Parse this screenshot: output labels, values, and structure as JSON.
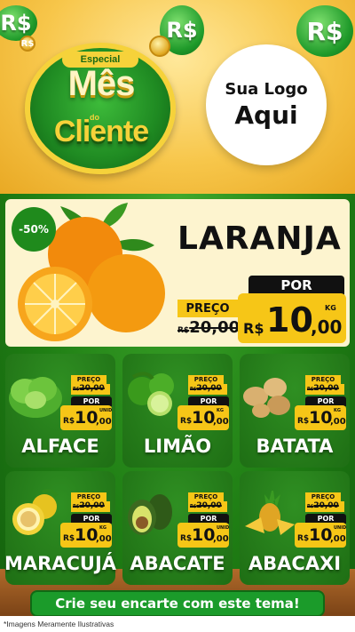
{
  "header": {
    "badge_especial": "Especial",
    "title_mes": "Mês",
    "title_do": "do",
    "title_cliente": "Cliente",
    "logo_line1": "Sua Logo",
    "logo_line2": "Aqui",
    "coin_symbol": "R$",
    "colors": {
      "green": "#1f8a22",
      "gold": "#f6d23a",
      "bg": "#f7c64a"
    }
  },
  "hero": {
    "discount": "-50%",
    "name": "LARANJA",
    "preco_label": "PREÇO",
    "old_price_rs": "R$",
    "old_price": "20,00",
    "por_label": "POR",
    "new_rs": "R$",
    "new_int": "10",
    "new_dec": ",00",
    "unit": "KG"
  },
  "products": [
    {
      "name": "ALFACE",
      "preco_label": "PREÇO",
      "old_rs": "R$",
      "old_price": "20,00",
      "por_label": "POR",
      "new_rs": "R$",
      "new_int": "10",
      "new_dec": ",00",
      "unit": "UNID"
    },
    {
      "name": "LIMÃO",
      "preco_label": "PREÇO",
      "old_rs": "R$",
      "old_price": "20,00",
      "por_label": "POR",
      "new_rs": "R$",
      "new_int": "10",
      "new_dec": ",00",
      "unit": "KG"
    },
    {
      "name": "BATATA",
      "preco_label": "PREÇO",
      "old_rs": "R$",
      "old_price": "20,00",
      "por_label": "POR",
      "new_rs": "R$",
      "new_int": "10",
      "new_dec": ",00",
      "unit": "KG"
    },
    {
      "name": "MARACUJÁ",
      "preco_label": "PREÇO",
      "old_rs": "R$",
      "old_price": "20,00",
      "por_label": "POR",
      "new_rs": "R$",
      "new_int": "10",
      "new_dec": ",00",
      "unit": "KG"
    },
    {
      "name": "ABACATE",
      "preco_label": "PREÇO",
      "old_rs": "R$",
      "old_price": "20,00",
      "por_label": "POR",
      "new_rs": "R$",
      "new_int": "10",
      "new_dec": ",00",
      "unit": "UNID"
    },
    {
      "name": "ABACAXI",
      "preco_label": "PREÇO",
      "old_rs": "R$",
      "old_price": "20,00",
      "por_label": "POR",
      "new_rs": "R$",
      "new_int": "10",
      "new_dec": ",00",
      "unit": "UNID"
    }
  ],
  "cta": {
    "label": "Crie seu encarte com este tema!"
  },
  "footer": {
    "note": "*Imagens Meramente Ilustrativas"
  }
}
